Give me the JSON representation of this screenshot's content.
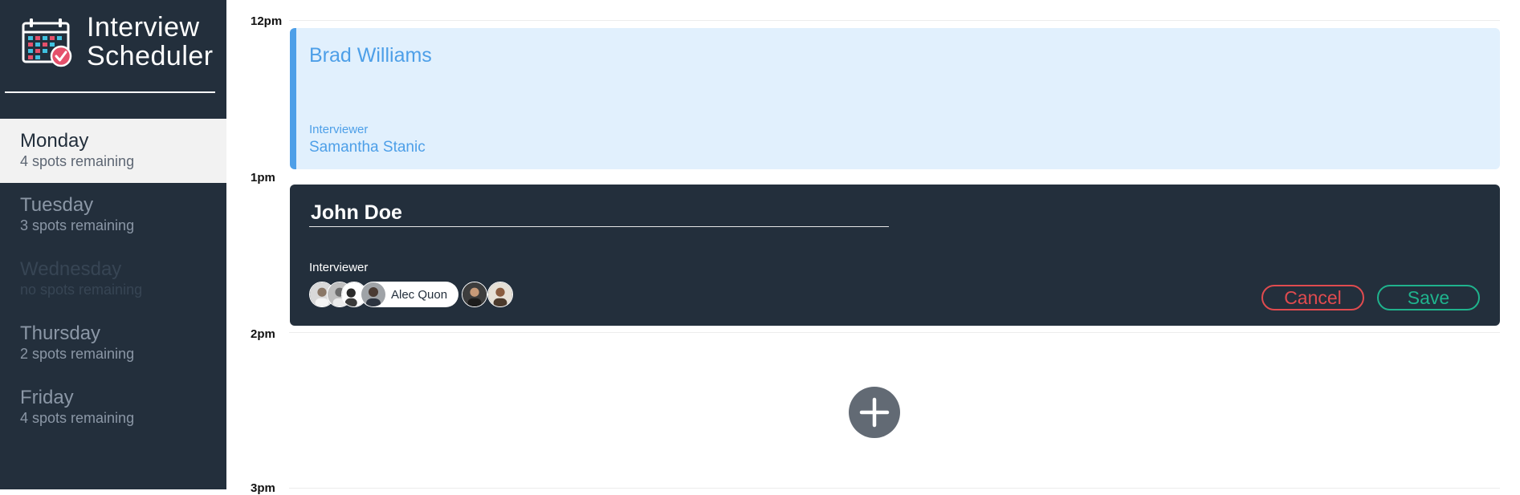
{
  "app": {
    "title_line1": "Interview",
    "title_line2": "Scheduler",
    "logo_icon": "calendar-check-icon"
  },
  "days": [
    {
      "name": "Monday",
      "spots": "4 spots remaining",
      "state": "active"
    },
    {
      "name": "Tuesday",
      "spots": "3 spots remaining",
      "state": "default"
    },
    {
      "name": "Wednesday",
      "spots": "no spots remaining",
      "state": "disabled"
    },
    {
      "name": "Thursday",
      "spots": "2 spots remaining",
      "state": "default"
    },
    {
      "name": "Friday",
      "spots": "4 spots remaining",
      "state": "default"
    }
  ],
  "hours": [
    "12pm",
    "1pm",
    "2pm",
    "3pm"
  ],
  "appointments": {
    "booked": {
      "student": "Brad Williams",
      "interviewer_label": "Interviewer",
      "interviewer": "Samantha Stanic"
    },
    "edit": {
      "student_value": "John Doe",
      "interviewer_label": "Interviewer",
      "selected_interviewer": "Alec Quon",
      "cancel_label": "Cancel",
      "save_label": "Save"
    }
  },
  "add_icon": "plus-icon",
  "colors": {
    "sidebar_bg": "#232f3c",
    "booked_bg": "#e1f0fd",
    "booked_accent": "#4d9fe8",
    "cancel": "#e04b4f",
    "save": "#1fb38d",
    "add_button": "#626a74"
  }
}
